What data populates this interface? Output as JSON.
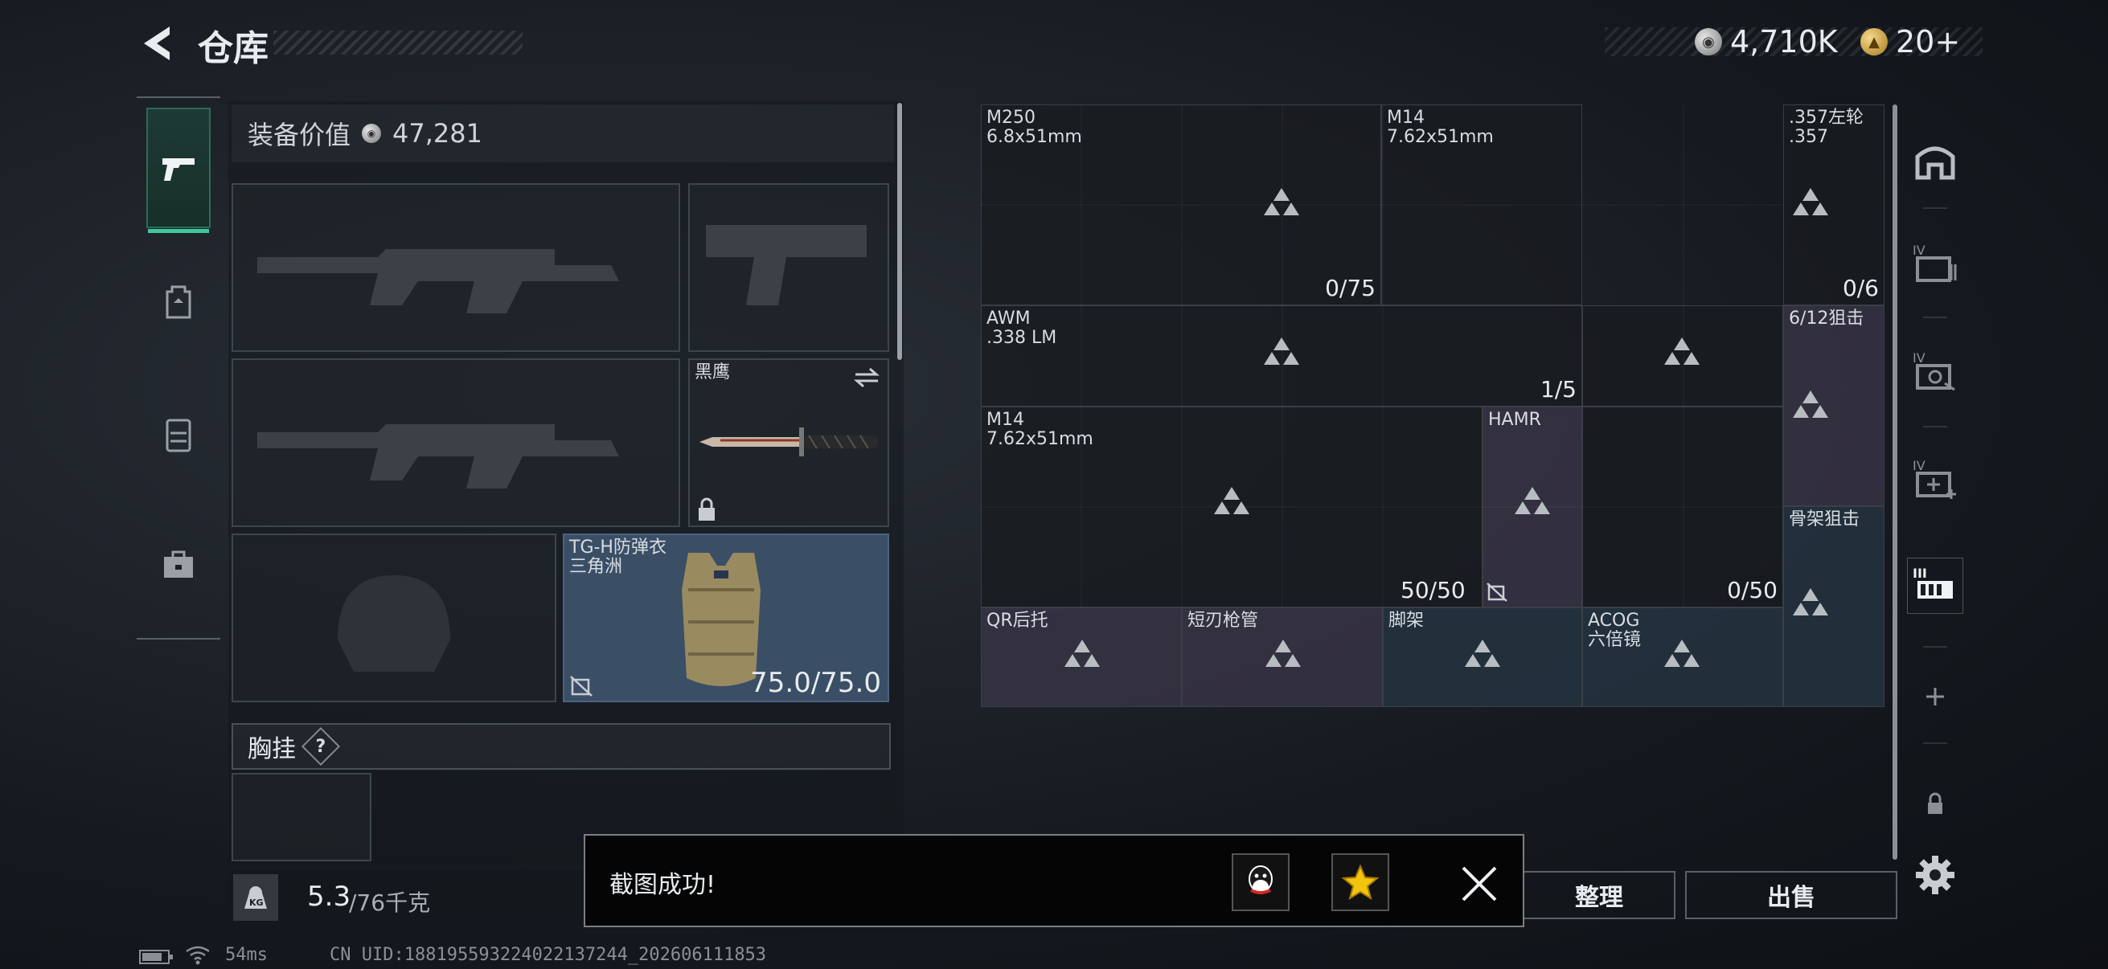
{
  "header": {
    "title": "仓库",
    "silver_amount": "4,710K",
    "gold_amount": "20+"
  },
  "equipment": {
    "value_label": "装备价值",
    "value_amount": "47,281",
    "melee_name": "黑鹰",
    "armor_name": "TG-H防弹衣",
    "armor_brand": "三角洲",
    "armor_durability": "75.0/75.0",
    "chest_label": "胸挂",
    "chest_help": "?"
  },
  "grid": {
    "m250_name": "M250",
    "m250_caliber": "6.8x51mm",
    "m250_count": "0/75",
    "m14a_name": "M14",
    "m14a_caliber": "7.62x51mm",
    "rev_name": ".357左轮",
    "rev_caliber": ".357",
    "rev_count": "0/6",
    "awm_name": "AWM",
    "awm_caliber": ".338 LM",
    "awm_count": "1/5",
    "shotgun_name": "6/12狙击",
    "m14b_name": "M14",
    "m14b_caliber": "7.62x51mm",
    "m14b_count": "50/50",
    "hamr_name": "HAMR",
    "slot_count": "0/50",
    "skeleton_name": "骨架狙击",
    "qr_name": "QR后托",
    "barrel_name": "短刃枪管",
    "bipod_name": "脚架",
    "acog_name": "ACOG",
    "acog_sub": "六倍镜"
  },
  "bottom": {
    "weight_current": "5.3",
    "weight_max": "/76千克",
    "kg_icon_label": "KG",
    "sort_label": "整理",
    "sell_label": "出售"
  },
  "toast": {
    "message": "截图成功!"
  },
  "statusbar": {
    "ping": "54ms",
    "uid": "CN UID:188195593224022137244_202606111853"
  },
  "colors": {
    "accent": "#3fc79b",
    "purple_slot": "#3a3448",
    "blue_slot": "#243442"
  },
  "icons": [
    "back-arrow-icon",
    "silver-coin-icon",
    "gold-coin-icon",
    "pistol-tab-icon",
    "backpack-tab-icon",
    "vest-tab-icon",
    "briefcase-tab-icon",
    "lock-icon",
    "swap-icon",
    "no-insure-icon",
    "help-icon",
    "home-icon",
    "plus-icon",
    "settings-icon",
    "kg-icon",
    "qq-icon",
    "star-icon",
    "close-icon",
    "battery-icon",
    "wifi-icon"
  ]
}
